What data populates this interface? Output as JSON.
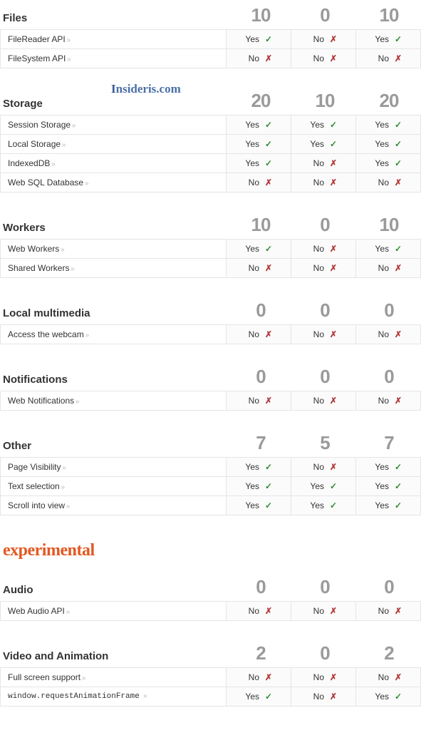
{
  "watermark": "Insideris.com",
  "heading_experimental": "experimental",
  "sections": [
    {
      "title": "Files",
      "scores": [
        "10",
        "0",
        "10"
      ],
      "rows": [
        {
          "label": "FileReader API",
          "vals": [
            "Yes",
            "No",
            "Yes"
          ]
        },
        {
          "label": "FileSystem API",
          "vals": [
            "No",
            "No",
            "No"
          ]
        }
      ]
    },
    {
      "title": "Storage",
      "scores": [
        "20",
        "10",
        "20"
      ],
      "watermark": true,
      "rows": [
        {
          "label": "Session Storage",
          "vals": [
            "Yes",
            "Yes",
            "Yes"
          ]
        },
        {
          "label": "Local Storage",
          "vals": [
            "Yes",
            "Yes",
            "Yes"
          ]
        },
        {
          "label": "IndexedDB",
          "vals": [
            "Yes",
            "No",
            "Yes"
          ]
        },
        {
          "label": "Web SQL Database",
          "vals": [
            "No",
            "No",
            "No"
          ]
        }
      ]
    },
    {
      "title": "Workers",
      "scores": [
        "10",
        "0",
        "10"
      ],
      "rows": [
        {
          "label": "Web Workers",
          "vals": [
            "Yes",
            "No",
            "Yes"
          ]
        },
        {
          "label": "Shared Workers",
          "vals": [
            "No",
            "No",
            "No"
          ]
        }
      ]
    },
    {
      "title": "Local multimedia",
      "scores": [
        "0",
        "0",
        "0"
      ],
      "rows": [
        {
          "label": "Access the webcam",
          "vals": [
            "No",
            "No",
            "No"
          ]
        }
      ]
    },
    {
      "title": "Notifications",
      "scores": [
        "0",
        "0",
        "0"
      ],
      "rows": [
        {
          "label": "Web Notifications",
          "vals": [
            "No",
            "No",
            "No"
          ]
        }
      ]
    },
    {
      "title": "Other",
      "scores": [
        "7",
        "5",
        "7"
      ],
      "rows": [
        {
          "label": "Page Visibility",
          "vals": [
            "Yes",
            "No",
            "Yes"
          ]
        },
        {
          "label": "Text selection",
          "vals": [
            "Yes",
            "Yes",
            "Yes"
          ]
        },
        {
          "label": "Scroll into view",
          "vals": [
            "Yes",
            "Yes",
            "Yes"
          ]
        }
      ]
    }
  ],
  "experimental_sections": [
    {
      "title": "Audio",
      "scores": [
        "0",
        "0",
        "0"
      ],
      "rows": [
        {
          "label": "Web Audio API",
          "vals": [
            "No",
            "No",
            "No"
          ]
        }
      ]
    },
    {
      "title": "Video and Animation",
      "scores": [
        "2",
        "0",
        "2"
      ],
      "rows": [
        {
          "label": "Full screen support",
          "vals": [
            "No",
            "No",
            "No"
          ]
        },
        {
          "label": "window.requestAnimationFrame",
          "mono": true,
          "vals": [
            "Yes",
            "No",
            "Yes"
          ]
        }
      ]
    }
  ]
}
